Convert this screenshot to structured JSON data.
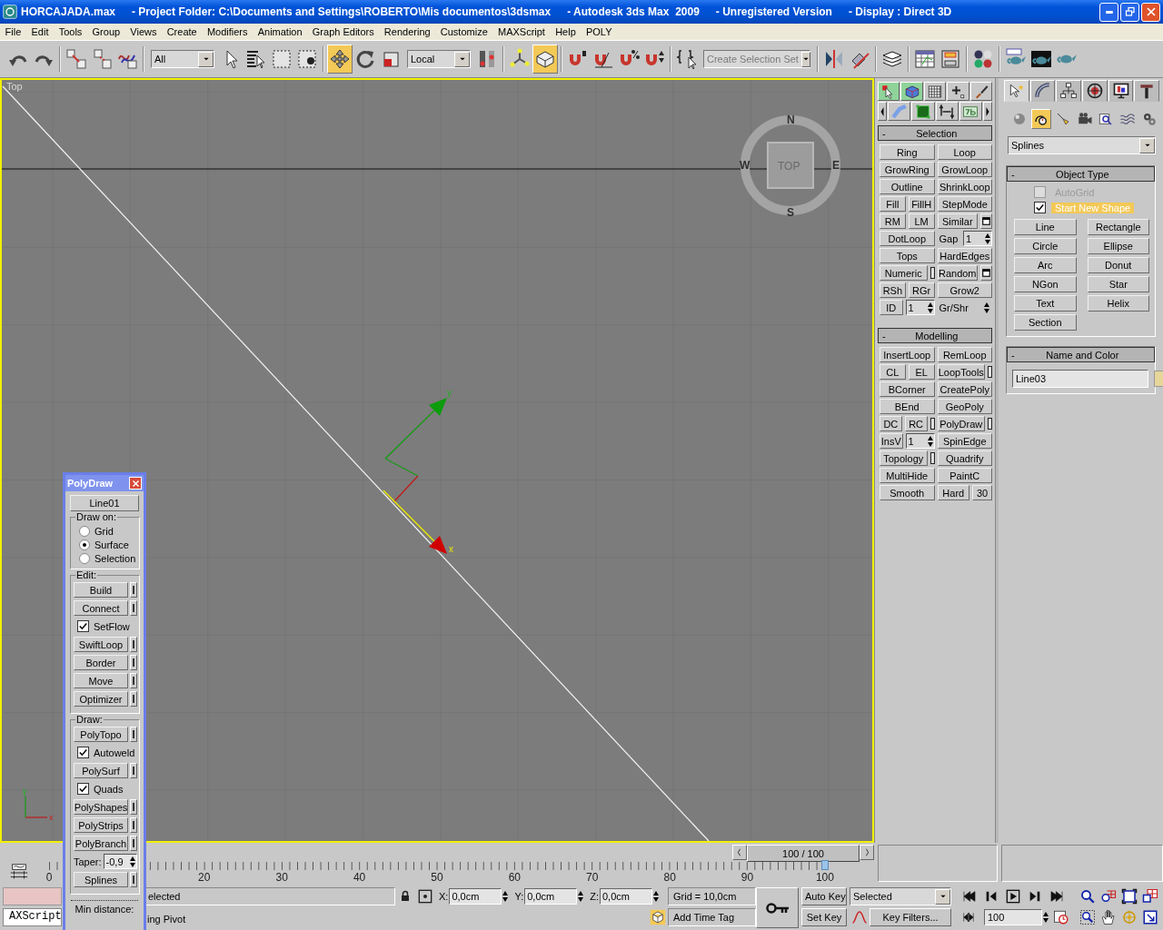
{
  "window": {
    "title_segments": [
      "HORCAJADA.max",
      "- Project Folder: C:\\Documents and Settings\\ROBERTO\\Mis documentos\\3dsmax",
      "- Autodesk 3ds Max  2009",
      "- Unregistered Version",
      "- Display : Direct 3D"
    ]
  },
  "menu": [
    "File",
    "Edit",
    "Tools",
    "Group",
    "Views",
    "Create",
    "Modifiers",
    "Animation",
    "Graph Editors",
    "Rendering",
    "Customize",
    "MAXScript",
    "Help",
    "POLY"
  ],
  "main_toolbar": [
    {
      "kind": "tool",
      "selected": false
    },
    {
      "kind": "tool",
      "selected": false
    },
    {
      "kind": "separator"
    },
    {
      "kind": "tool",
      "selected": false
    },
    {
      "kind": "tool",
      "selected": false
    },
    {
      "kind": "tool",
      "selected": false
    },
    {
      "kind": "separator"
    },
    {
      "kind": "dropdown",
      "value": "All"
    },
    {
      "kind": "tool",
      "selected": false
    },
    {
      "kind": "tool",
      "selected": false
    },
    {
      "kind": "tool",
      "selected": false
    },
    {
      "kind": "tool",
      "selected": false
    },
    {
      "kind": "separator"
    },
    {
      "kind": "tool",
      "selected": true
    },
    {
      "kind": "tool",
      "selected": false
    },
    {
      "kind": "tool",
      "selected": false
    },
    {
      "kind": "dropdown",
      "value": "Local"
    },
    {
      "kind": "tool",
      "selected": false
    },
    {
      "kind": "separator"
    },
    {
      "kind": "tool",
      "selected": false
    },
    {
      "kind": "tool",
      "selected": true
    },
    {
      "kind": "separator"
    },
    {
      "kind": "tool",
      "selected": false
    },
    {
      "kind": "tool",
      "selected": false
    },
    {
      "kind": "tool",
      "selected": false
    },
    {
      "kind": "tool",
      "selected": false
    },
    {
      "kind": "separator"
    },
    {
      "kind": "tool",
      "selected": false
    },
    {
      "kind": "dropdown",
      "placeholder": "Create Selection Set"
    },
    {
      "kind": "separator"
    },
    {
      "kind": "tool",
      "selected": false
    },
    {
      "kind": "tool",
      "selected": false
    },
    {
      "kind": "separator"
    },
    {
      "kind": "tool",
      "selected": false
    },
    {
      "kind": "separator"
    },
    {
      "kind": "tool",
      "selected": false
    },
    {
      "kind": "tool",
      "selected": false
    },
    {
      "kind": "separator"
    },
    {
      "kind": "tool",
      "selected": false
    },
    {
      "kind": "separator"
    },
    {
      "kind": "tool",
      "selected": false
    },
    {
      "kind": "tool",
      "selected": false
    },
    {
      "kind": "tool",
      "selected": false
    }
  ],
  "viewport": {
    "label": "Top",
    "viewcube_face": "TOP",
    "compass": [
      "N",
      "E",
      "S",
      "W"
    ],
    "gizmo_axes": [
      "y",
      "x"
    ],
    "tripod_axes": [
      "y",
      "x"
    ]
  },
  "modeling_panel": {
    "top_icons": [
      {
        "selected": true
      },
      {
        "selected": true
      },
      {
        "selected": false
      },
      {
        "selected": false
      },
      {
        "selected": false
      }
    ],
    "rollouts": [
      {
        "collapse_sign": "-",
        "title": "Selection",
        "rows": [
          {
            "left": [
              {
                "kind": "button",
                "label": "Ring"
              }
            ],
            "right": [
              {
                "kind": "button",
                "label": "Loop"
              }
            ]
          },
          {
            "left": [
              {
                "kind": "button",
                "label": "GrowRing"
              }
            ],
            "right": [
              {
                "kind": "button",
                "label": "GrowLoop"
              }
            ]
          },
          {
            "left": [
              {
                "kind": "button",
                "label": "Outline"
              }
            ],
            "right": [
              {
                "kind": "button",
                "label": "ShrinkLoop"
              }
            ]
          },
          {
            "left": [
              {
                "kind": "button",
                "label": "Fill"
              },
              {
                "kind": "button",
                "label": "FillH"
              }
            ],
            "right": [
              {
                "kind": "button",
                "label": "StepMode"
              }
            ]
          },
          {
            "left": [
              {
                "kind": "button",
                "label": "RM"
              },
              {
                "kind": "button",
                "label": "LM"
              }
            ],
            "right": [
              {
                "kind": "button",
                "label": "Similar"
              },
              {
                "kind": "box"
              }
            ]
          },
          {
            "left": [
              {
                "kind": "button",
                "label": "DotLoop"
              }
            ],
            "right": [
              {
                "kind": "text",
                "label": "Gap"
              },
              {
                "kind": "spinner",
                "value": "1"
              }
            ]
          },
          {
            "left": [
              {
                "kind": "button",
                "label": "Tops"
              }
            ],
            "right": [
              {
                "kind": "button",
                "label": "HardEdges"
              }
            ]
          },
          {
            "left": [
              {
                "kind": "button",
                "label": "Numeric"
              },
              {
                "kind": "slot"
              }
            ],
            "right": [
              {
                "kind": "button",
                "label": "Random"
              },
              {
                "kind": "box"
              }
            ]
          },
          {
            "left": [
              {
                "kind": "button",
                "label": "RSh"
              },
              {
                "kind": "button",
                "label": "RGr"
              }
            ],
            "right": [
              {
                "kind": "button",
                "label": "Grow2"
              }
            ]
          },
          {
            "left": [
              {
                "kind": "button",
                "label": "ID"
              },
              {
                "kind": "spinner",
                "value": "1"
              }
            ],
            "right": [
              {
                "kind": "text",
                "label": "Gr/Shr"
              },
              {
                "kind": "arrows"
              }
            ]
          }
        ]
      },
      {
        "collapse_sign": "-",
        "title": "Modelling",
        "rows": [
          {
            "left": [
              {
                "kind": "button",
                "label": "InsertLoop"
              }
            ],
            "right": [
              {
                "kind": "button",
                "label": "RemLoop"
              }
            ]
          },
          {
            "left": [
              {
                "kind": "button",
                "label": "CL"
              },
              {
                "kind": "button",
                "label": "EL"
              }
            ],
            "right": [
              {
                "kind": "button",
                "label": "LoopTools"
              },
              {
                "kind": "slot"
              }
            ]
          },
          {
            "left": [
              {
                "kind": "button",
                "label": "BCorner"
              }
            ],
            "right": [
              {
                "kind": "button",
                "label": "CreatePoly"
              }
            ]
          },
          {
            "left": [
              {
                "kind": "button",
                "label": "BEnd"
              }
            ],
            "right": [
              {
                "kind": "button",
                "label": "GeoPoly"
              }
            ]
          },
          {
            "left": [
              {
                "kind": "button",
                "label": "DC"
              },
              {
                "kind": "button",
                "label": "RC"
              },
              {
                "kind": "slot"
              }
            ],
            "right": [
              {
                "kind": "button",
                "label": "PolyDraw"
              },
              {
                "kind": "slot"
              }
            ]
          },
          {
            "left": [
              {
                "kind": "button",
                "label": "InsV"
              },
              {
                "kind": "spinner",
                "value": "1"
              }
            ],
            "right": [
              {
                "kind": "button",
                "label": "SpinEdge"
              }
            ]
          },
          {
            "left": [
              {
                "kind": "button",
                "label": "Topology"
              },
              {
                "kind": "slot"
              }
            ],
            "right": [
              {
                "kind": "button",
                "label": "Quadrify"
              }
            ]
          },
          {
            "left": [
              {
                "kind": "button",
                "label": "MultiHide"
              }
            ],
            "right": [
              {
                "kind": "button",
                "label": "PaintC"
              }
            ]
          },
          {
            "left": [
              {
                "kind": "button",
                "label": "Smooth"
              }
            ],
            "right": [
              {
                "kind": "button",
                "label": "Hard"
              },
              {
                "kind": "small",
                "label": "30"
              }
            ]
          }
        ]
      }
    ]
  },
  "command_panel": {
    "tabs": [
      {
        "selected": true
      },
      {
        "selected": false
      },
      {
        "selected": false
      },
      {
        "selected": false
      },
      {
        "selected": false
      },
      {
        "selected": false
      }
    ],
    "categories": [
      {
        "selected": false
      },
      {
        "selected": true
      },
      {
        "selected": false
      },
      {
        "selected": false
      },
      {
        "selected": false
      },
      {
        "selected": false
      },
      {
        "selected": false
      }
    ],
    "type_dropdown": "Splines",
    "object_type": {
      "collapse_sign": "-",
      "title": "Object Type",
      "checkboxes": [
        {
          "label": "AutoGrid",
          "checked": false,
          "disabled": true
        },
        {
          "label": "Start New Shape",
          "checked": true,
          "disabled": false
        }
      ],
      "buttons": [
        "Line",
        "Rectangle",
        "Circle",
        "Ellipse",
        "Arc",
        "Donut",
        "NGon",
        "Star",
        "Text",
        "Helix",
        "Section"
      ]
    },
    "name_color": {
      "collapse_sign": "-",
      "title": "Name and Color",
      "name": "Line03",
      "color": "#e6d69a"
    }
  },
  "polydraw": {
    "title": "PolyDraw",
    "object": "Line01",
    "groups": [
      {
        "title": "Draw on:",
        "items": [
          {
            "kind": "radio",
            "label": "Grid",
            "selected": false
          },
          {
            "kind": "radio",
            "label": "Surface",
            "selected": true
          },
          {
            "kind": "radio",
            "label": "Selection",
            "selected": false
          }
        ]
      },
      {
        "title": "Edit:",
        "items": [
          {
            "kind": "button",
            "label": "Build"
          },
          {
            "kind": "button",
            "label": "Connect"
          },
          {
            "kind": "check",
            "label": "SetFlow",
            "checked": true
          },
          {
            "kind": "button",
            "label": "SwiftLoop"
          },
          {
            "kind": "button",
            "label": "Border"
          },
          {
            "kind": "button",
            "label": "Move"
          },
          {
            "kind": "button",
            "label": "Optimizer"
          }
        ]
      },
      {
        "title": "Draw:",
        "items": [
          {
            "kind": "button",
            "label": "PolyTopo"
          },
          {
            "kind": "check",
            "label": "Autoweld",
            "checked": true
          },
          {
            "kind": "button",
            "label": "PolySurf"
          },
          {
            "kind": "check",
            "label": "Quads",
            "checked": true
          },
          {
            "kind": "button",
            "label": "PolyShapes"
          },
          {
            "kind": "button",
            "label": "PolyStrips"
          },
          {
            "kind": "button",
            "label": "PolyBranch"
          },
          {
            "kind": "spinner",
            "label": "Taper:",
            "value": "-0,9"
          },
          {
            "kind": "button",
            "label": "Splines"
          }
        ]
      }
    ],
    "min_distance": "Min distance:"
  },
  "timeline": {
    "time_slider": {
      "label": "100 / 100",
      "level": 1
    },
    "ruler": {
      "labels": [
        "0",
        "20",
        "30",
        "40",
        "50",
        "60",
        "70",
        "80",
        "90",
        "100"
      ],
      "level": 1
    }
  },
  "status": {
    "script_label": "AXScript",
    "prompt": "elected",
    "hint": "ing Pivot",
    "coords": [
      {
        "axis": "X:",
        "value": "0,0cm"
      },
      {
        "axis": "Y:",
        "value": "0,0cm"
      },
      {
        "axis": "Z:",
        "value": "0,0cm"
      }
    ],
    "grid": "Grid = 10,0cm",
    "time_tag": "Add Time Tag",
    "auto_key": "Auto Key",
    "set_key": "Set Key",
    "key_mode": "Selected",
    "key_filters": "Key Filters...",
    "frame": "100"
  }
}
